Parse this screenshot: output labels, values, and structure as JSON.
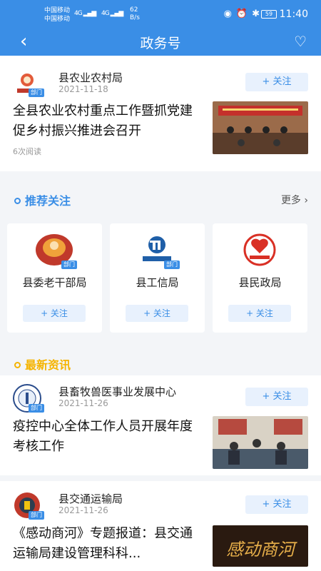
{
  "status_bar": {
    "carrier_1": "中国移动",
    "carrier_2": "中国移动",
    "signal_1": "4G",
    "signal_2": "4G",
    "net_speed": "62",
    "net_unit": "B/s",
    "battery": "59",
    "time": "11:40"
  },
  "header": {
    "back_icon": "chevron-left-icon",
    "title": "政务号",
    "fav_icon": "heart-plus-icon"
  },
  "top_article": {
    "source": "县农业农村局",
    "badge": "部门",
    "date": "2021-11-18",
    "follow_label": "+ 关注",
    "headline": "全县农业农村重点工作暨抓党建促乡村振兴推进会召开",
    "reads": "6次阅读"
  },
  "recommend": {
    "title": "推荐关注",
    "more": "更多",
    "items": [
      {
        "name": "县委老干部局",
        "badge": "部门",
        "follow_label": "+ 关注"
      },
      {
        "name": "县工信局",
        "badge": "部门",
        "follow_label": "+ 关注"
      },
      {
        "name": "县民政局",
        "badge": "",
        "follow_label": "+ 关注"
      }
    ]
  },
  "latest": {
    "title": "最新资讯",
    "items": [
      {
        "source": "县畜牧兽医事业发展中心",
        "badge": "部门",
        "date": "2021-11-26",
        "follow_label": "+ 关注",
        "headline": "疫控中心全体工作人员开展年度考核工作"
      },
      {
        "source": "县交通运输局",
        "badge": "部门",
        "date": "2021-11-26",
        "follow_label": "+ 关注",
        "headline": "《感动商河》专题报道：县交通运输局建设管理科科...",
        "thumb_text": "感动商河"
      }
    ]
  },
  "colors": {
    "brand": "#3a8ee6",
    "follow_bg": "#e8f1fd",
    "recommend_dot": "#3a8ee6",
    "latest_dot": "#f5b400"
  }
}
